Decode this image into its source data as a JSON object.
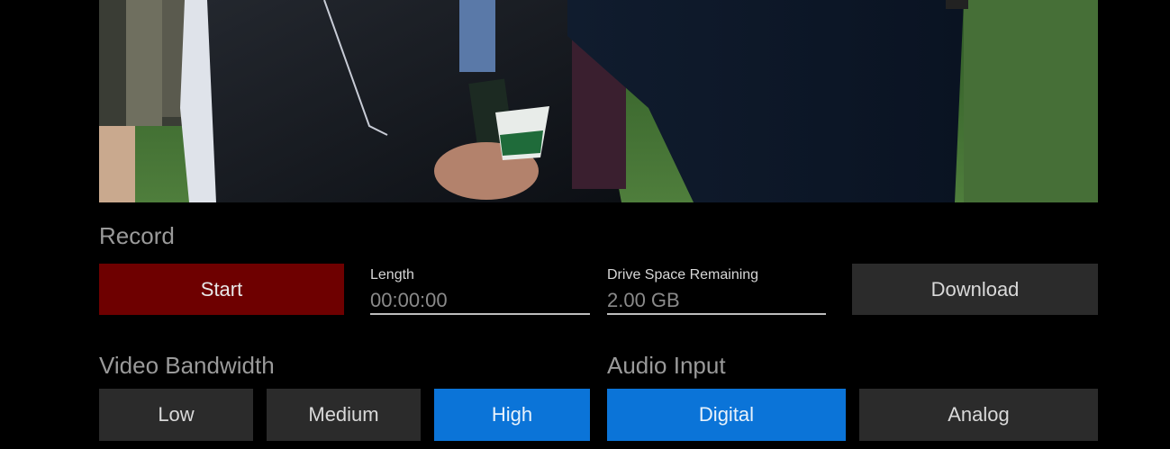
{
  "preview": {
    "colors": {
      "field": "#3f6a33",
      "jacket": "#141a22",
      "coat": "#0f1a2c",
      "skin": "#b3826c"
    }
  },
  "record": {
    "title": "Record",
    "start_label": "Start",
    "length_label": "Length",
    "length_value": "00:00:00",
    "drive_label": "Drive Space Remaining",
    "drive_value": "2.00 GB",
    "download_label": "Download"
  },
  "video_bandwidth": {
    "title": "Video Bandwidth",
    "options": [
      "Low",
      "Medium",
      "High"
    ],
    "selected": "High"
  },
  "audio_input": {
    "title": "Audio Input",
    "options": [
      "Digital",
      "Analog"
    ],
    "selected": "Digital"
  },
  "colors": {
    "background": "#000000",
    "button": "#2b2b2b",
    "record_button": "#6e0000",
    "active_button": "#0b74d8",
    "section_title": "#9a9a9a"
  }
}
